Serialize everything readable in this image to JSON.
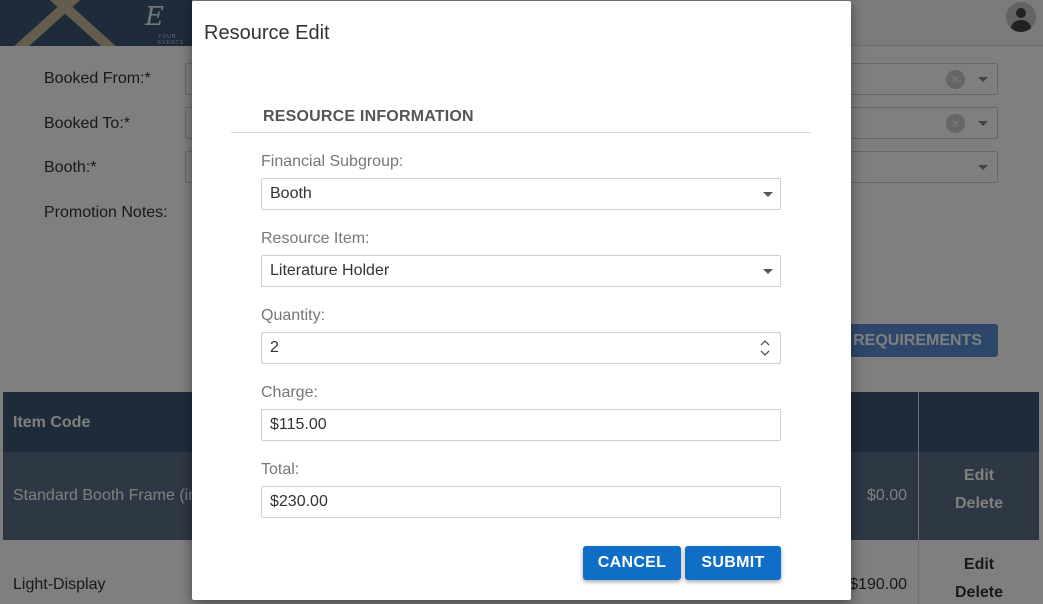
{
  "background": {
    "form": {
      "booked_from_label": "Booked From:*",
      "booked_to_label": "Booked To:*",
      "booth_label": "Booth:*",
      "promotion_notes_label": "Promotion Notes:"
    },
    "requirements_button": "REQUIREMENTS",
    "table": {
      "header_item_code": "Item Code",
      "rows": [
        {
          "name": "Standard Booth Frame (in",
          "amount": "$0.00",
          "edit": "Edit",
          "delete": "Delete"
        },
        {
          "name": "Light-Display",
          "amount": "$190.00",
          "edit": "Edit",
          "delete": "Delete"
        }
      ]
    }
  },
  "modal": {
    "title": "Resource Edit",
    "section_title": "RESOURCE INFORMATION",
    "financial_subgroup": {
      "label": "Financial Subgroup:",
      "value": "Booth"
    },
    "resource_item": {
      "label": "Resource Item:",
      "value": "Literature Holder"
    },
    "quantity": {
      "label": "Quantity:",
      "value": "2"
    },
    "charge": {
      "label": "Charge:",
      "value": "$115.00"
    },
    "total": {
      "label": "Total:",
      "value": "$230.00"
    },
    "cancel_label": "CANCEL",
    "submit_label": "SUBMIT"
  },
  "colors": {
    "primary": "#0f6fc6",
    "header": "#3d5674"
  },
  "icons": [
    "clear-icon",
    "chevron-down-icon",
    "spinner-icon",
    "user-avatar-icon"
  ]
}
